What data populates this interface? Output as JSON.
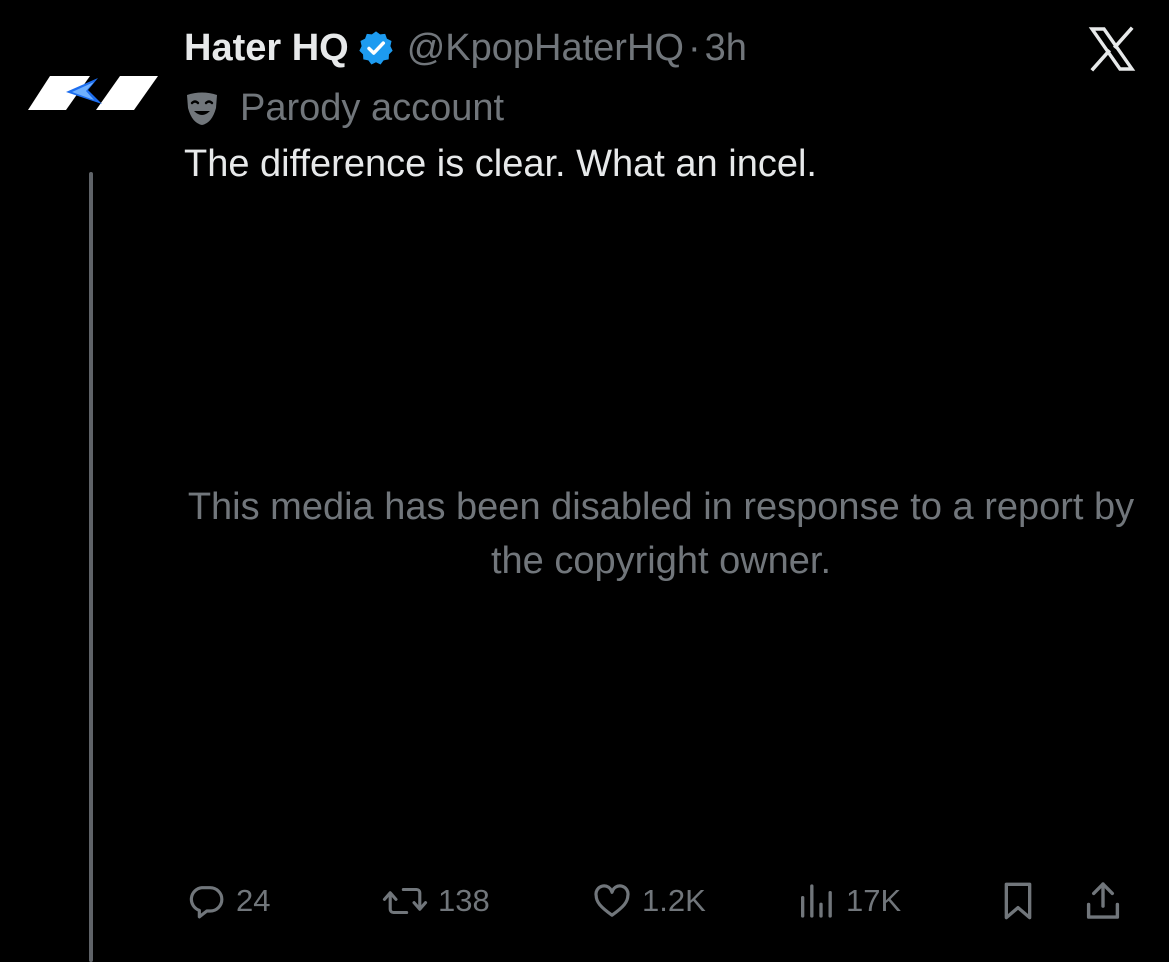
{
  "tweet": {
    "display_name": "Hater HQ",
    "handle": "@KpopHaterHQ",
    "separator": "·",
    "time": "3h",
    "label": "Parody account",
    "text": "The difference is clear. What an incel.",
    "media_notice": "This media has been disabled in response to a report by the copyright owner.",
    "verified_icon": "verified-badge-icon",
    "label_icon": "parody-mask-icon"
  },
  "actions": {
    "replies": "24",
    "reposts": "138",
    "likes": "1.2K",
    "views": "17K"
  },
  "colors": {
    "background": "#000000",
    "primary_text": "#e7e9ea",
    "secondary_text": "#71767b",
    "verified_blue": "#1d9bf0",
    "thread_line": "#5f6368"
  }
}
